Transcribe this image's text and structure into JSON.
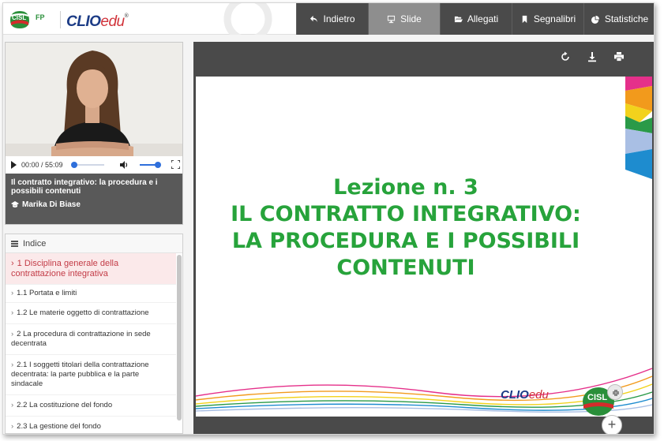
{
  "header": {
    "logo_cisl_text": "CISL",
    "logo_fp_text": "FP",
    "logo_clio_text": "CLIO",
    "logo_edu_text": "EDU",
    "nav": [
      {
        "label": "Indietro",
        "icon": "arrow-back-icon"
      },
      {
        "label": "Slide",
        "icon": "monitor-icon"
      },
      {
        "label": "Allegati",
        "icon": "folder-icon"
      },
      {
        "label": "Segnalibri",
        "icon": "bookmark-icon"
      },
      {
        "label": "Statistiche",
        "icon": "pie-chart-icon"
      }
    ]
  },
  "video": {
    "time": "00:00 / 55:09",
    "lesson_title": "Il contratto integrativo: la procedura e i possibili contenuti",
    "author": "Marika Di Biase"
  },
  "index": {
    "title": "Indice",
    "items": [
      "1 Disciplina generale della contrattazione integrativa",
      "1.1 Portata e limiti",
      "1.2 Le materie oggetto di contrattazione",
      "2 La procedura di contrattazione in sede decentrata",
      "2.1 I soggetti titolari della contrattazione decentrata: la parte pubblica e la parte sindacale",
      "2.2 La costituzione del fondo",
      "2.3 La gestione del fondo"
    ]
  },
  "slide": {
    "line1": "Lezione n. 3",
    "line2": "IL CONTRATTO INTEGRATIVO:",
    "line3": "LA PROCEDURA E I POSSIBILI",
    "line4": "CONTENUTI",
    "footer_clio": "CLIO",
    "footer_edu": "EDU",
    "footer_cisl": "CISL",
    "plus": "+"
  },
  "colors": {
    "slide_text": "#27a33b",
    "nav_bg": "#4a4a4a",
    "nav_active": "#8e8e8e",
    "index_active": "#c33c47"
  }
}
